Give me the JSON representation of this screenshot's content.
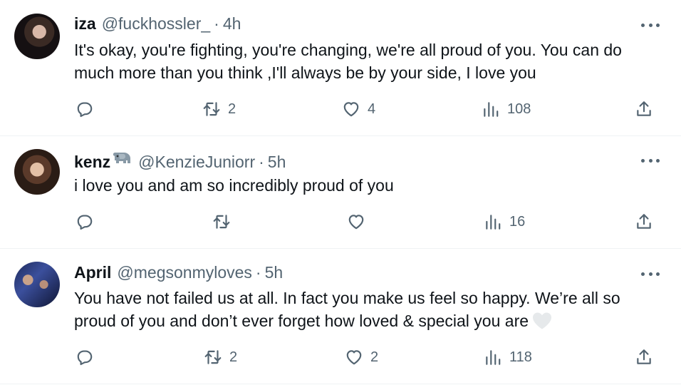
{
  "tweets": [
    {
      "name": "iza",
      "handle": "@fuckhossler_",
      "separator": "·",
      "time": "4h",
      "text": "It's okay, you're fighting, you're changing, we're all proud of you. You can do much more than you think ,I'll always be by your side, I love you",
      "replies": "",
      "retweets": "2",
      "likes": "4",
      "views": "108"
    },
    {
      "name": "kenz",
      "name_emoji": "elephant-emoji",
      "handle": "@KenzieJuniorr",
      "separator": "·",
      "time": "5h",
      "text": "i love you and am so incredibly proud of you",
      "replies": "",
      "retweets": "",
      "likes": "",
      "views": "16"
    },
    {
      "name": "April",
      "handle": "@megsonmyloves",
      "separator": "·",
      "time": "5h",
      "text": "You have not failed us at all. In fact you make us feel so happy. We’re all so proud of you and don’t ever forget how loved & special you are",
      "text_emoji": "white-heart-emoji",
      "replies": "",
      "retweets": "2",
      "likes": "2",
      "views": "118"
    }
  ],
  "icons": {
    "reply": "reply-icon",
    "retweet": "retweet-icon",
    "like": "heart-icon",
    "views": "views-icon",
    "share": "share-icon",
    "more": "more-icon"
  },
  "colors": {
    "text": "#0f1419",
    "secondary": "#536471",
    "divider": "#eff3f4"
  }
}
